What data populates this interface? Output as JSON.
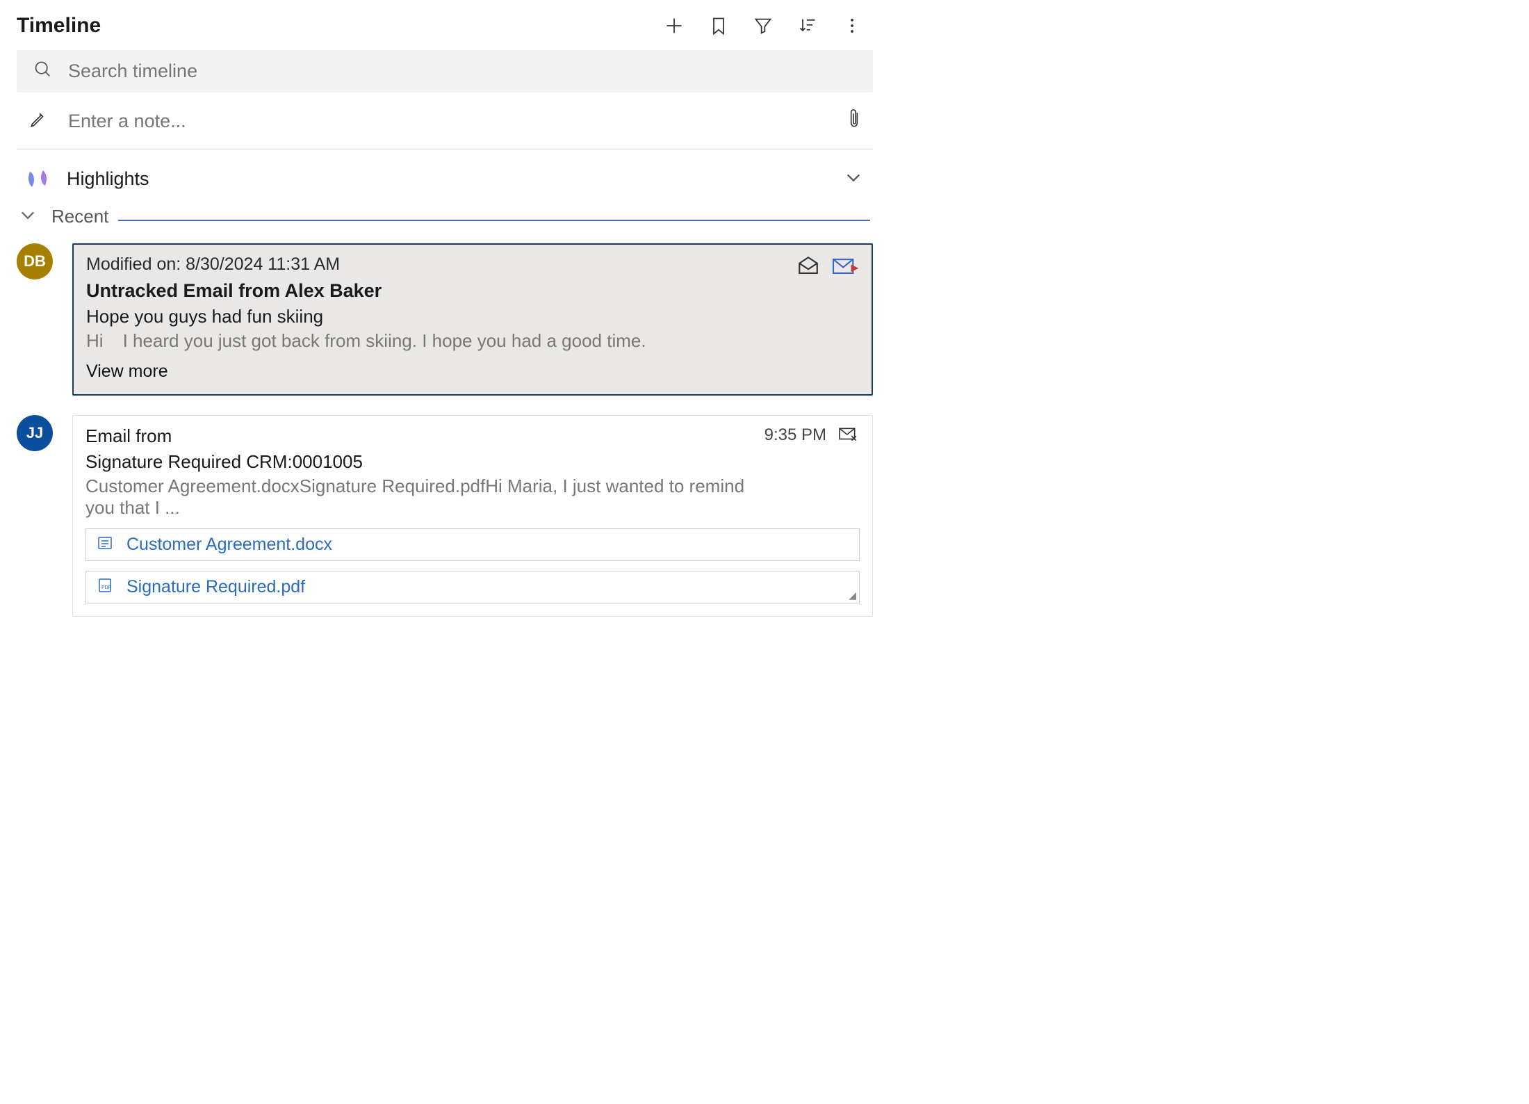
{
  "header": {
    "title": "Timeline"
  },
  "search": {
    "placeholder": "Search timeline"
  },
  "note": {
    "placeholder": "Enter a note..."
  },
  "highlights": {
    "label": "Highlights"
  },
  "section": {
    "label": "Recent"
  },
  "items": [
    {
      "avatar": "DB",
      "avatar_color": "#a88000",
      "meta": "Modified on: 8/30/2024 11:31 AM",
      "title": "Untracked Email from Alex Baker",
      "line1": "Hope you guys had fun skiing",
      "preview_a": "Hi",
      "preview_b": "I heard you just got back from skiing.  I hope you had a good time.",
      "viewmore": "View more"
    },
    {
      "avatar": "JJ",
      "avatar_color": "#0b4e9e",
      "title": "Email from",
      "time": "9:35 PM",
      "line1": "Signature Required CRM:0001005",
      "preview": "Customer Agreement.docxSignature Required.pdfHi Maria, I just wanted to remind you that I ...",
      "attachments": [
        {
          "name": "Customer Agreement.docx",
          "type": "docx"
        },
        {
          "name": "Signature Required.pdf",
          "type": "pdf"
        }
      ]
    }
  ]
}
